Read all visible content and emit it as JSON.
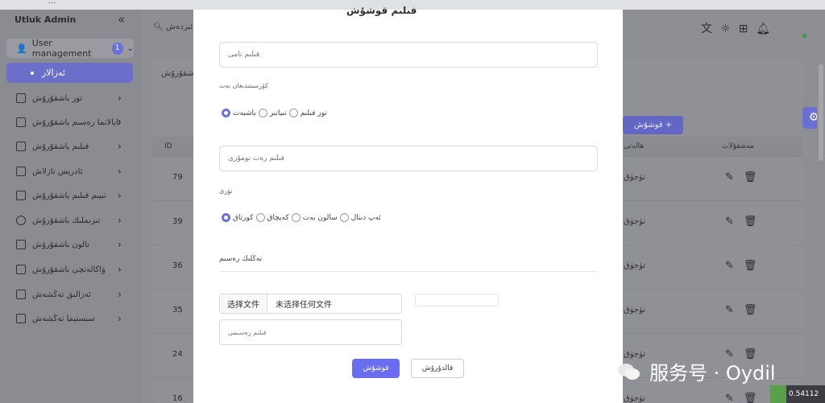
{
  "browser": {
    "url": "...",
    "profile": ""
  },
  "sidebar": {
    "brand": "Utluk Admin",
    "collapse_icon": "«",
    "user_management": {
      "label": "User management",
      "badge": "1"
    },
    "active": "ئەزالار",
    "items": [
      {
        "label": "تور باشقۇرۇش",
        "icon": "copy-icon"
      },
      {
        "label": "ئايالانما رەسىم باشقۇرۇش",
        "icon": "cube-icon"
      },
      {
        "label": "فىلىم باشقۇرۇش",
        "icon": "file-icon"
      },
      {
        "label": "ئادرېس تازلاش",
        "icon": "file-icon"
      },
      {
        "label": "تىپىم فىلىم باشقۇرۇش",
        "icon": "file-icon"
      },
      {
        "label": "تىزىملىك باشقۇرۇش",
        "icon": "list-icon"
      },
      {
        "label": "تالون باشقۇرۇش",
        "icon": "flask-icon"
      },
      {
        "label": "ۋاكالەتچى باشقۇرۇش",
        "icon": "flask-icon"
      },
      {
        "label": "ئەزالىق تەڭشەش",
        "icon": "flask-icon"
      },
      {
        "label": "سىستېما تەڭشەش",
        "icon": "flask-icon"
      }
    ]
  },
  "topbar": {
    "search": "ئىزدەش"
  },
  "main": {
    "card_title": "باشقۇرۇش",
    "add_button": "قوشۇش +",
    "columns": {
      "id": "ID",
      "status": "ھالەتى",
      "ops": "مەشغۇلات"
    },
    "rows": [
      {
        "id": "79",
        "status": "تۈجۈق"
      },
      {
        "id": "39",
        "status": "تۈجۈق"
      },
      {
        "id": "36",
        "status": "تۈجۈق"
      },
      {
        "id": "35",
        "status": "تۈجۈق"
      },
      {
        "id": "24",
        "status": "تۈجۈق"
      },
      {
        "id": "16",
        "status": "تۈجۈق"
      }
    ]
  },
  "modal": {
    "title": "فىلىم قوشۇش",
    "name_placeholder": "فىلىم نامى",
    "show_label": "كۆرسىتىدىغان بەت",
    "show_options": [
      "باشبەت",
      "تىياتىر",
      "تور فىلىم"
    ],
    "number_placeholder": "فىلىم رەت نومۇرى",
    "type_label": "تۈرى",
    "type_options": [
      "كورتاق",
      "كەيچاق",
      "سالون بەت",
      "ئەپ دىتال"
    ],
    "section_title": "تەڭلىك رەسىم",
    "file_pick": "选择文件",
    "file_none": "未选择任何文件",
    "poster_placeholder": "فىلىم رەسىمى",
    "save": "قوشۇش",
    "cancel": "قالدۇرۇش"
  },
  "watermark": {
    "text": "服务号 · Oydil",
    "corner": "0.54112"
  },
  "colors": {
    "accent": "#6a6df0",
    "sidebar_active": "#6b6fc9",
    "online": "#2ea043"
  }
}
